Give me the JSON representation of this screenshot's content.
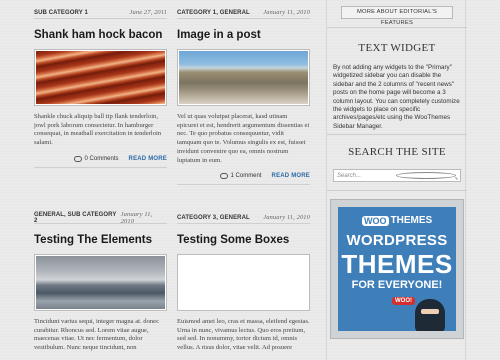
{
  "posts": [
    {
      "category": "SUB CATEGORY 1",
      "date": "June 27, 2011",
      "title": "Shank ham hock bacon",
      "excerpt": "Shankle chuck aliquip ball tip flank tenderloin, jowl pork laborum consectetur. In hamburger consequat, in meatball exercitation in tenderloin salami.",
      "comments": "0 Comments",
      "read_more": "READ MORE",
      "thumb": "bacon-image"
    },
    {
      "category": "CATEGORY 1, GENERAL",
      "date": "January 11, 2010",
      "title": "Image in a post",
      "excerpt": "Vel ut quas volutpat placerat, kasd utinam epicurei et est, hendrerit argumentum dissentias ei nec. Te quo probatus consequuntur, vidit tamquam quo te. Volumus singulis ex est, fuisset invidunt convenire quo ea, omnis nostrum luptatum in eum.",
      "comments": "1 Comment",
      "read_more": "READ MORE",
      "thumb": "aerial-coast-image"
    },
    {
      "category": "GENERAL, SUB CATEGORY 2",
      "date": "January 11, 2010",
      "title": "Testing The Elements",
      "excerpt": "Tincidunt varius sequi, integer magna at. donec curabitur. Rhoncus sed. Lorem vitae augue, maecenas vitae. Ut nec fermentum, dolor vestibulum. Nunc neque tincidunt, non",
      "thumb": "airport-image"
    },
    {
      "category": "CATEGORY 3, GENERAL",
      "date": "January 11, 2010",
      "title": "Testing Some Boxes",
      "excerpt": "Euismod amet leo, cras et massa, eleifend egestas. Urna in nunc, vivamus lectus. Quo eros pretium, sed sed. In nonummy, tortor dictum id, omnis vellus. A risus dolor, vitae velit. Ad posuere",
      "thumb": "vineyard-image"
    }
  ],
  "sidebar": {
    "features_button": "MORE ABOUT EDITORIAL'S FEATURES",
    "text_widget_title": "TEXT WIDGET",
    "text_widget_body": "By not adding any widgets to the \"Primary\" widgetized sidebar you can disable the sidebar and the 2 columns of \"recent news\" posts on the home page will become a 3 column layout. You can completely customize the widgets to place on specific archives/pages/etc using the WooThemes Sidebar Manager.",
    "search_title": "SEARCH THE SITE",
    "search_placeholder": "Search...",
    "ad": {
      "logo_badge": "WOO",
      "logo_text": "THEMES",
      "line1": "WORDPRESS",
      "line2": "THEMES",
      "line3": "FOR EVERYONE!",
      "bubble": "WOO!"
    }
  }
}
